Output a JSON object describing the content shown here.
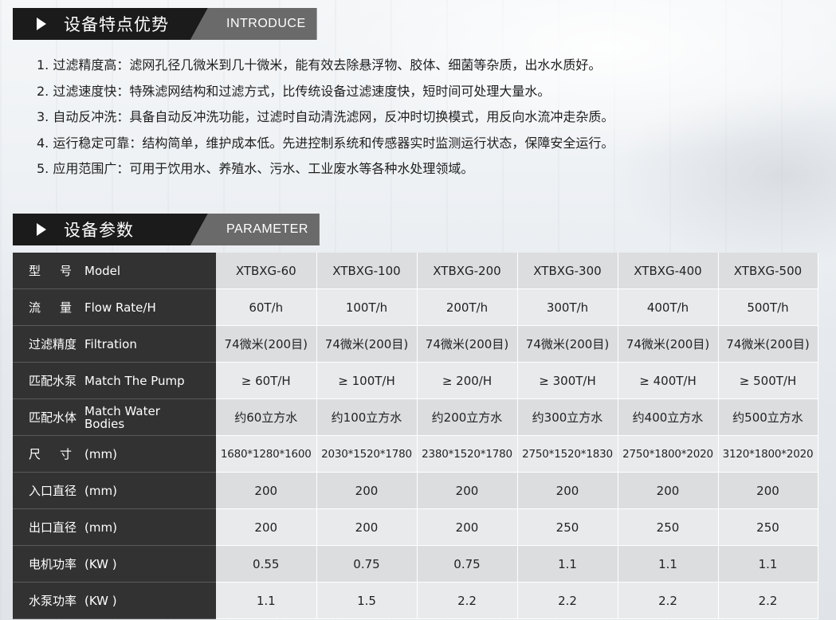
{
  "sections": {
    "features": {
      "title": "设备特点优势",
      "subtitle": "INTRODUCE"
    },
    "params": {
      "title": "设备参数",
      "subtitle": "PARAMETER"
    }
  },
  "features": [
    "1. 过滤精度高：滤网孔径几微米到几十微米，能有效去除悬浮物、胶体、细菌等杂质，出水水质好。",
    "2. 过滤速度快：特殊滤网结构和过滤方式，比传统设备过滤速度快，短时间可处理大量水。",
    "3. 自动反冲洗：具备自动反冲洗功能，过滤时自动清洗滤网，反冲时切换模式，用反向水流冲走杂质。",
    "4. 运行稳定可靠：结构简单，维护成本低。先进控制系统和传感器实时监测运行状态，保障安全运行。",
    "5. 应用范围广：可用于饮用水、养殖水、污水、工业废水等各种水处理领域。"
  ],
  "table": {
    "rows": [
      {
        "cn": "型号",
        "en": "Model",
        "values": [
          "XTBXG-60",
          "XTBXG-100",
          "XTBXG-200",
          "XTBXG-300",
          "XTBXG-400",
          "XTBXG-500"
        ]
      },
      {
        "cn": "流量",
        "en": "Flow Rate/H",
        "values": [
          "60T/h",
          "100T/h",
          "200T/h",
          "300T/h",
          "400T/h",
          "500T/h"
        ]
      },
      {
        "cn": "过滤精度",
        "en": "Filtration",
        "values": [
          "74微米(200目)",
          "74微米(200目)",
          "74微米(200目)",
          "74微米(200目)",
          "74微米(200目)",
          "74微米(200目)"
        ]
      },
      {
        "cn": "匹配水泵",
        "en": "Match The Pump",
        "values": [
          "≥ 60T/H",
          "≥ 100T/H",
          "≥ 200/H",
          "≥ 300T/H",
          "≥ 400T/H",
          "≥ 500T/H"
        ]
      },
      {
        "cn": "匹配水体",
        "en": "Match Water Bodies",
        "values": [
          "约60立方水",
          "约100立方水",
          "约200立方水",
          "约300立方水",
          "约400立方水",
          "约500立方水"
        ]
      },
      {
        "cn": "尺寸",
        "en": "(mm)",
        "values": [
          "1680*1280*1600",
          "2030*1520*1780",
          "2380*1520*1780",
          "2750*1520*1830",
          "2750*1800*2020",
          "3120*1800*2020"
        ]
      },
      {
        "cn": "入口直径",
        "en": "(mm)",
        "values": [
          "200",
          "200",
          "200",
          "200",
          "200",
          "200"
        ]
      },
      {
        "cn": "出口直径",
        "en": "(mm)",
        "values": [
          "200",
          "200",
          "200",
          "250",
          "250",
          "250"
        ]
      },
      {
        "cn": "电机功率",
        "en": "(KW )",
        "values": [
          "0.55",
          "0.75",
          "0.75",
          "1.1",
          "1.1",
          "1.1"
        ]
      },
      {
        "cn": "水泵功率",
        "en": "(KW )",
        "values": [
          "1.1",
          "1.5",
          "2.2",
          "2.2",
          "2.2",
          "2.2"
        ]
      }
    ]
  }
}
